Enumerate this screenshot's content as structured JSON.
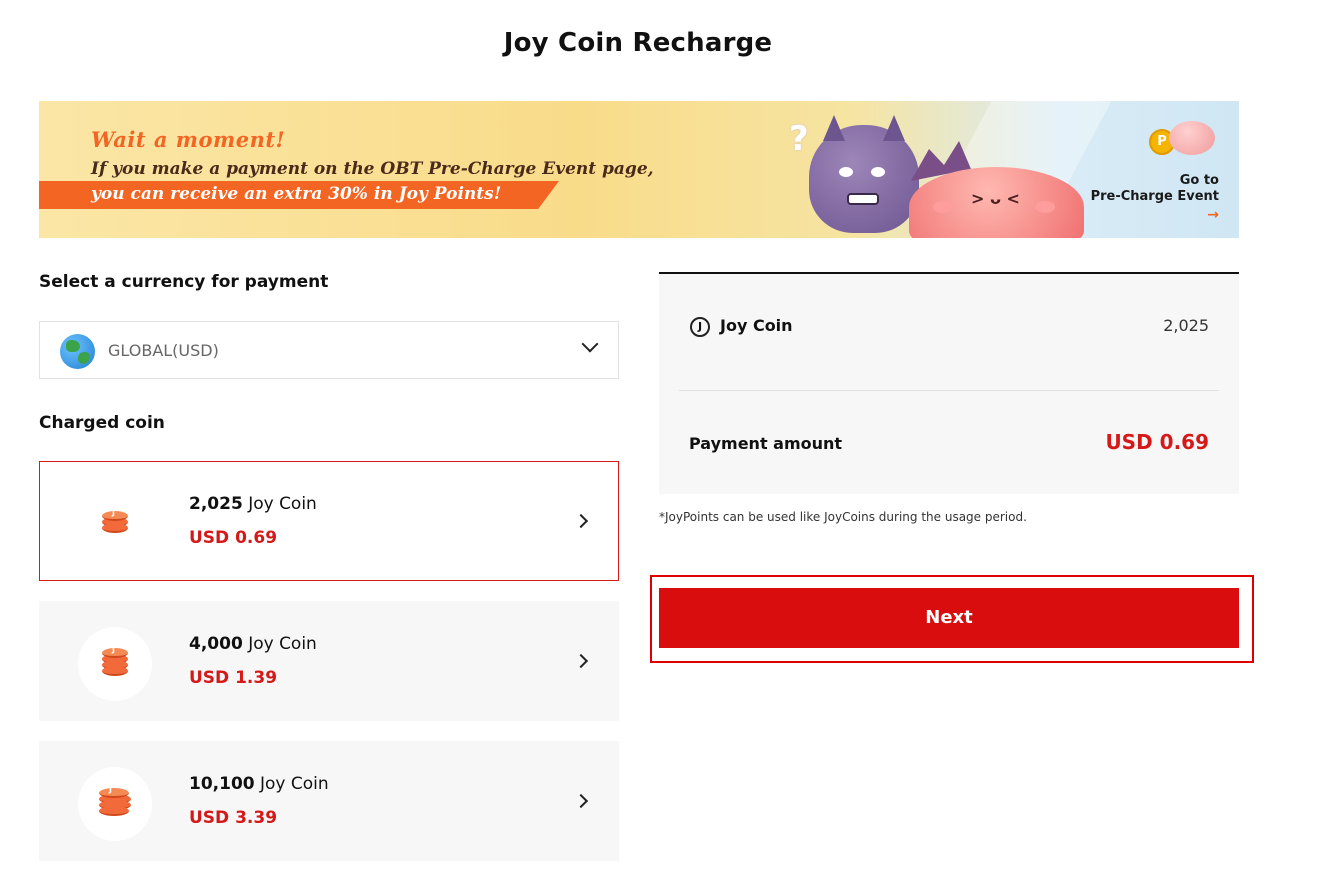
{
  "page": {
    "title": "Joy Coin Recharge"
  },
  "banner": {
    "headline": "Wait a moment!",
    "line2": "If you make a payment on the OBT Pre-Charge Event page,",
    "line3": "you can receive an extra 30% in Joy Points!",
    "goto_line1": "Go to",
    "goto_line2": "Pre-Charge Event",
    "arrow": "→",
    "question_mark": "?",
    "points_badge": "P",
    "accent_color": "#f26522"
  },
  "currency": {
    "label": "Select a currency for payment",
    "selected": "GLOBAL(USD)",
    "icon": "globe-icon"
  },
  "charged": {
    "label": "Charged coin",
    "items": [
      {
        "amount": "2,025",
        "unit": "Joy Coin",
        "price": "USD 0.69",
        "selected": true
      },
      {
        "amount": "4,000",
        "unit": "Joy Coin",
        "price": "USD 1.39",
        "selected": false
      },
      {
        "amount": "10,100",
        "unit": "Joy Coin",
        "price": "USD 3.39",
        "selected": false
      }
    ]
  },
  "summary": {
    "coin_icon": "J",
    "coin_label": "Joy Coin",
    "coin_value": "2,025",
    "payment_label": "Payment amount",
    "payment_value": "USD 0.69",
    "note": "*JoyPoints can be used like JoyCoins during the usage period."
  },
  "actions": {
    "next_label": "Next"
  },
  "colors": {
    "accent_red": "#d51919",
    "button_red": "#d90d0d",
    "card_bg": "#f7f7f7"
  }
}
